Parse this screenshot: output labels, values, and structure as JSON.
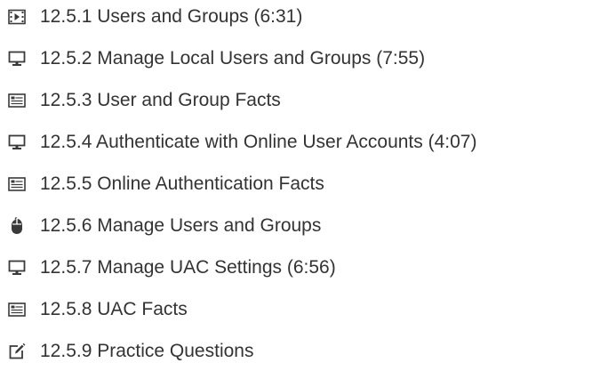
{
  "lesson_items": [
    {
      "label": "12.5.1 Users and Groups (6:31)",
      "icon": "video-icon"
    },
    {
      "label": "12.5.2 Manage Local Users and Groups (7:55)",
      "icon": "monitor-icon"
    },
    {
      "label": "12.5.3 User and Group Facts",
      "icon": "text-document-icon"
    },
    {
      "label": "12.5.4 Authenticate with Online User Accounts (4:07)",
      "icon": "monitor-icon"
    },
    {
      "label": "12.5.5 Online Authentication Facts",
      "icon": "text-document-icon"
    },
    {
      "label": "12.5.6 Manage Users and Groups",
      "icon": "mouse-icon"
    },
    {
      "label": "12.5.7 Manage UAC Settings (6:56)",
      "icon": "monitor-icon"
    },
    {
      "label": "12.5.8 UAC Facts",
      "icon": "text-document-icon"
    },
    {
      "label": "12.5.9 Practice Questions",
      "icon": "edit-question-icon"
    }
  ],
  "colors": {
    "text": "#333333",
    "icon": "#3a3a3a",
    "background": "#ffffff"
  }
}
